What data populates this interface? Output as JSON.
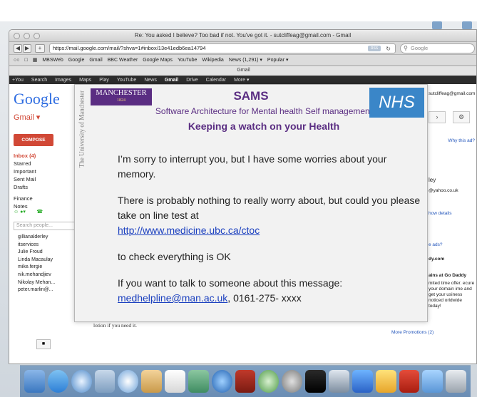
{
  "browser": {
    "window_title": "Re: You asked I believe? Too bad if not. You've got it. - sutcliffeag@gmail.com - Gmail",
    "back_label": "◀",
    "forward_label": "▶",
    "add_label": "+",
    "url": "https://mail.google.com/mail/?shva=1#inbox/13e41edb6ea14794",
    "rss_label": "RSS",
    "search_placeholder": "Google",
    "bookmarks": [
      "MBSWeb",
      "Google",
      "Gmail",
      "BBC Weather",
      "Google Maps",
      "YouTube",
      "Wikipedia",
      "News (1,291) ▾",
      "Popular ▾"
    ],
    "tab_label": "Gmail"
  },
  "google_bar": {
    "items": [
      "+You",
      "Search",
      "Images",
      "Maps",
      "Play",
      "YouTube",
      "News",
      "Gmail",
      "Drive",
      "Calendar",
      "More ▾"
    ],
    "current": "Gmail"
  },
  "gmail": {
    "logo": "Google",
    "label": "Gmail ▾",
    "compose_label": "COMPOSE",
    "folders": [
      "Inbox (4)",
      "Starred",
      "Important",
      "Sent Mail",
      "Drafts",
      "",
      "Finance",
      "Notes"
    ],
    "people_search_placeholder": "Search people...",
    "contacts": [
      "gillianalderley",
      "itservices",
      "Julie Froud",
      "Linda Macaulay",
      "mike.fergie",
      "nik.mehandjiev",
      "Nikolay Mehan...",
      "peter.marlin@..."
    ],
    "account_email": "sutcliffeag@gmail.com",
    "why_ad": "Why this ad?",
    "sender_name": "ley",
    "sender_email": "@yahoo.co.uk",
    "show_details": "how details",
    "ads_label": "e ads?",
    "ad_domain": "dy.com",
    "ad_title": "ains at Go Daddy",
    "ad_text": "mited time offer. ecure your domain ime and get your usiness noticed orldwide today!",
    "more_promotions": "More Promotions (2)",
    "message_text": "A. and I (I think) have both had shingles, but I don't know about the Hinds. Hope you're feeling better soon. We have lots of surplus calomine lotion if you need it."
  },
  "popup": {
    "logo_text": "MANCHESTER",
    "logo_year": "1824",
    "university_text": "The University of Manchester",
    "title": "SAMS",
    "subtitle": "Software Architecture for Mental health Self management",
    "tagline": "Keeping a watch on your Health",
    "nhs_logo": "NHS",
    "line1": "I’m sorry to interrupt you, but I have some worries about your memory.",
    "line2": "There is probably nothing to really worry about, but could you please take on line test at",
    "test_link": "http://www.medicine.ubc.ca/ctoc",
    "line3": "to check everything is OK",
    "line4": "If you  want to talk to someone about this message:",
    "contact_email": "medhelpline@man.ac.uk",
    "contact_phone": ", 0161-275- xxxx"
  },
  "colors": {
    "manchester_purple": "#5a2d82",
    "nhs_blue": "#3a86c8",
    "gmail_red": "#d14836"
  },
  "dock": {
    "icons": [
      "finder-icon",
      "appstore-icon",
      "safari-icon",
      "preview-icon",
      "itunes-icon",
      "photo-icon",
      "calendar-icon",
      "iphoto-icon",
      "music-icon",
      "photobooth-icon",
      "timemachine-icon",
      "system-prefs-icon",
      "kindle-icon",
      "stickies-icon",
      "people-icon",
      "paint-icon",
      "pdf-icon",
      "folder-icon",
      "trash-icon"
    ]
  }
}
